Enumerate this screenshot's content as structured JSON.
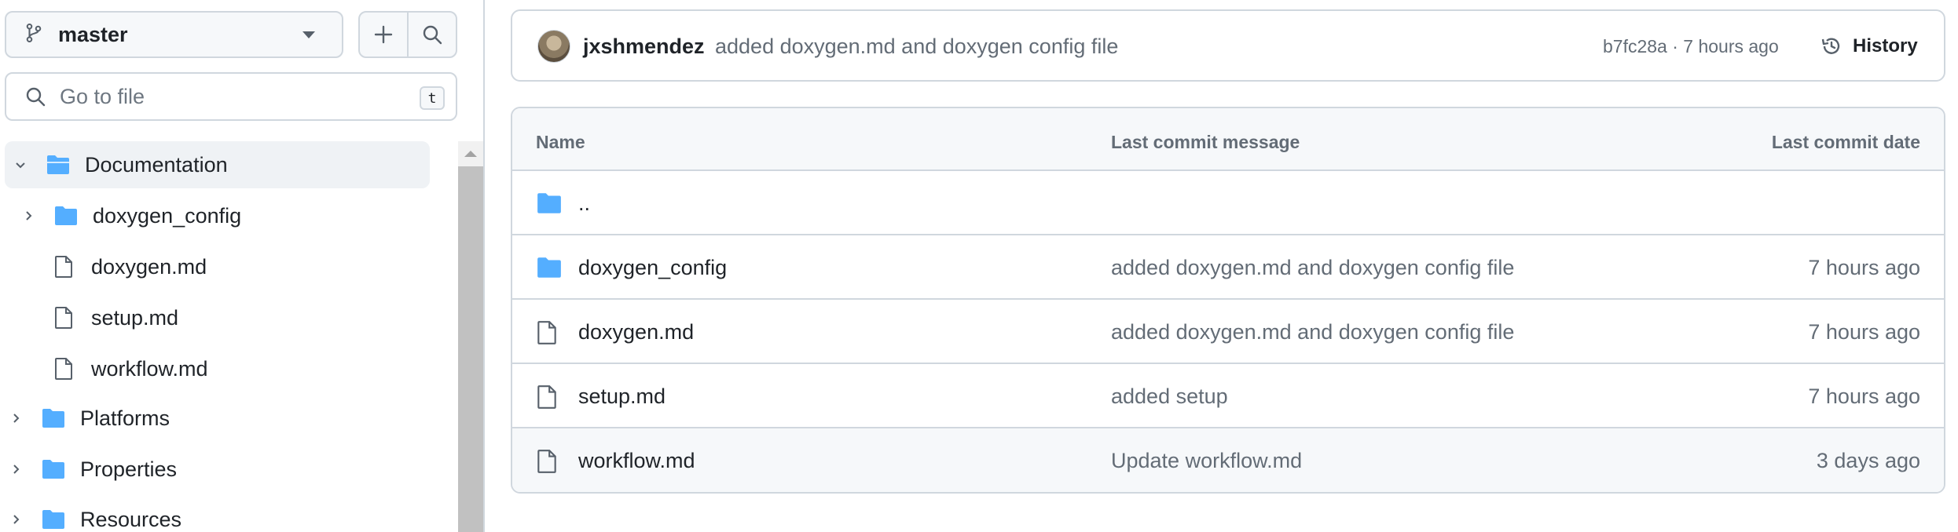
{
  "sidebar": {
    "branch": {
      "label": "master"
    },
    "search": {
      "placeholder": "Go to file",
      "shortcut": "t"
    },
    "tree": [
      {
        "label": "Documentation",
        "type": "folder-open",
        "expanded": true,
        "selected": true,
        "depth": 0
      },
      {
        "label": "doxygen_config",
        "type": "folder",
        "expanded": false,
        "depth": 1
      },
      {
        "label": "doxygen.md",
        "type": "file",
        "depth": 1
      },
      {
        "label": "setup.md",
        "type": "file",
        "depth": 1
      },
      {
        "label": "workflow.md",
        "type": "file",
        "depth": 1
      },
      {
        "label": "Platforms",
        "type": "folder",
        "expanded": false,
        "depth": 0
      },
      {
        "label": "Properties",
        "type": "folder",
        "expanded": false,
        "depth": 0
      },
      {
        "label": "Resources",
        "type": "folder",
        "expanded": false,
        "depth": 0
      }
    ]
  },
  "latest_commit": {
    "author": "jxshmendez",
    "message": "added doxygen.md and doxygen config file",
    "sha_time": "b7fc28a · 7 hours ago",
    "history_label": "History"
  },
  "table": {
    "headers": {
      "name": "Name",
      "message": "Last commit message",
      "date": "Last commit date"
    },
    "parent_label": "..",
    "rows": [
      {
        "name": "doxygen_config",
        "type": "folder",
        "message": "added doxygen.md and doxygen config file",
        "date": "7 hours ago"
      },
      {
        "name": "doxygen.md",
        "type": "file",
        "message": "added doxygen.md and doxygen config file",
        "date": "7 hours ago"
      },
      {
        "name": "setup.md",
        "type": "file",
        "message": "added setup",
        "date": "7 hours ago"
      },
      {
        "name": "workflow.md",
        "type": "file",
        "message": "Update workflow.md",
        "date": "3 days ago"
      }
    ]
  },
  "colors": {
    "folder": "#54aeff",
    "border": "#d0d7de",
    "muted_text": "#636c76",
    "selected_bg": "#eff2f5"
  }
}
